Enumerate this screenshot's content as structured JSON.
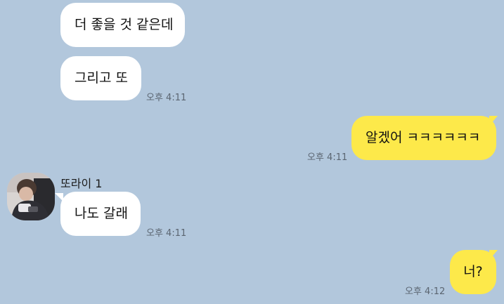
{
  "theme": {
    "background": "#b2c7dc",
    "incoming_bubble": "#ffffff",
    "outgoing_bubble": "#fde94a",
    "timestamp_color": "#5b6571"
  },
  "messages": [
    {
      "direction": "incoming",
      "text": "더 좋을 것 같은데",
      "time": ""
    },
    {
      "direction": "incoming",
      "text": "그리고 또",
      "time": "오후 4:11"
    },
    {
      "direction": "outgoing",
      "text": "알겠어 ㅋㅋㅋㅋㅋㅋ",
      "time": "오후 4:11"
    },
    {
      "direction": "incoming",
      "sender": "또라이 1",
      "avatar_icon": "profile-photo-icon",
      "text": "나도 갈래",
      "time": "오후 4:11"
    },
    {
      "direction": "outgoing",
      "text": "너?",
      "time": "오후 4:12"
    }
  ]
}
